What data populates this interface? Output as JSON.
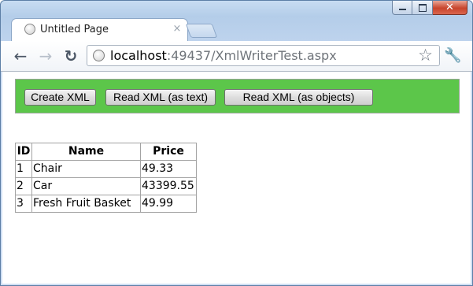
{
  "browser": {
    "tab_title": "Untitled Page",
    "tab_close_glyph": "×",
    "url_host": "localhost",
    "url_rest": ":49437/XmlWriterTest.aspx",
    "icons": {
      "back": "arrow-left-icon",
      "forward": "arrow-right-icon",
      "reload": "reload-icon",
      "star": "star-icon",
      "wrench": "wrench-icon",
      "page": "globe-icon"
    },
    "window_buttons": {
      "minimize": "minimize-icon",
      "maximize": "maximize-icon",
      "close_glyph": "✕"
    }
  },
  "page": {
    "panel_color": "#5cc64a",
    "buttons": [
      {
        "label": "Create XML"
      },
      {
        "label": "Read XML (as text)"
      },
      {
        "label": "Read XML (as objects)"
      }
    ],
    "table": {
      "headers": [
        "ID",
        "Name",
        "Price"
      ],
      "rows": [
        [
          "1",
          "Chair",
          "49.33"
        ],
        [
          "2",
          "Car",
          "43399.55"
        ],
        [
          "3",
          "Fresh Fruit Basket",
          "49.99"
        ]
      ]
    }
  }
}
